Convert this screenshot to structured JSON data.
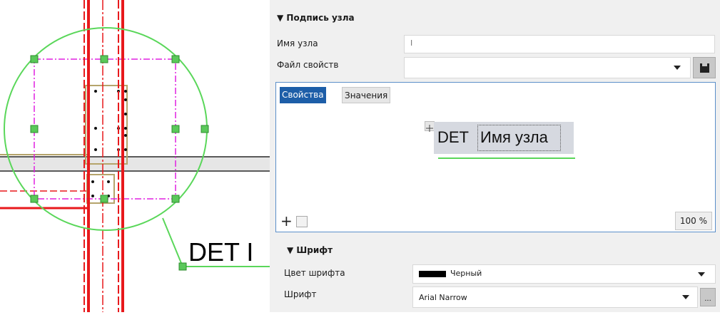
{
  "drawing": {
    "detail_label": "DET I"
  },
  "panel": {
    "node_label_section": {
      "header": "▼ Подпись узла",
      "node_name_label": "Имя узла",
      "node_name_value": "I",
      "properties_file_label": "Файл свойств",
      "properties_file_value": ""
    },
    "editor": {
      "tabs": [
        {
          "label": "Свойства",
          "active": true
        },
        {
          "label": "Значения",
          "active": false
        }
      ],
      "tag_prefix": "DET",
      "tag_field": "Имя узла",
      "zoom": "100 %",
      "add_button": "+",
      "move_icon": "move-icon"
    },
    "font_section": {
      "header": "▼ Шрифт",
      "color_label": "Цвет шрифта",
      "color_value": "Черный",
      "color_swatch": "#000000",
      "font_label": "Шрифт",
      "font_value": "Arial Narrow",
      "more_button": "..."
    }
  },
  "colors": {
    "accent": "#1d5ea8",
    "handle_green": "#5ac85a",
    "circle_green": "#5ad75a",
    "magenta": "#e020e0",
    "red": "#e8191c"
  }
}
